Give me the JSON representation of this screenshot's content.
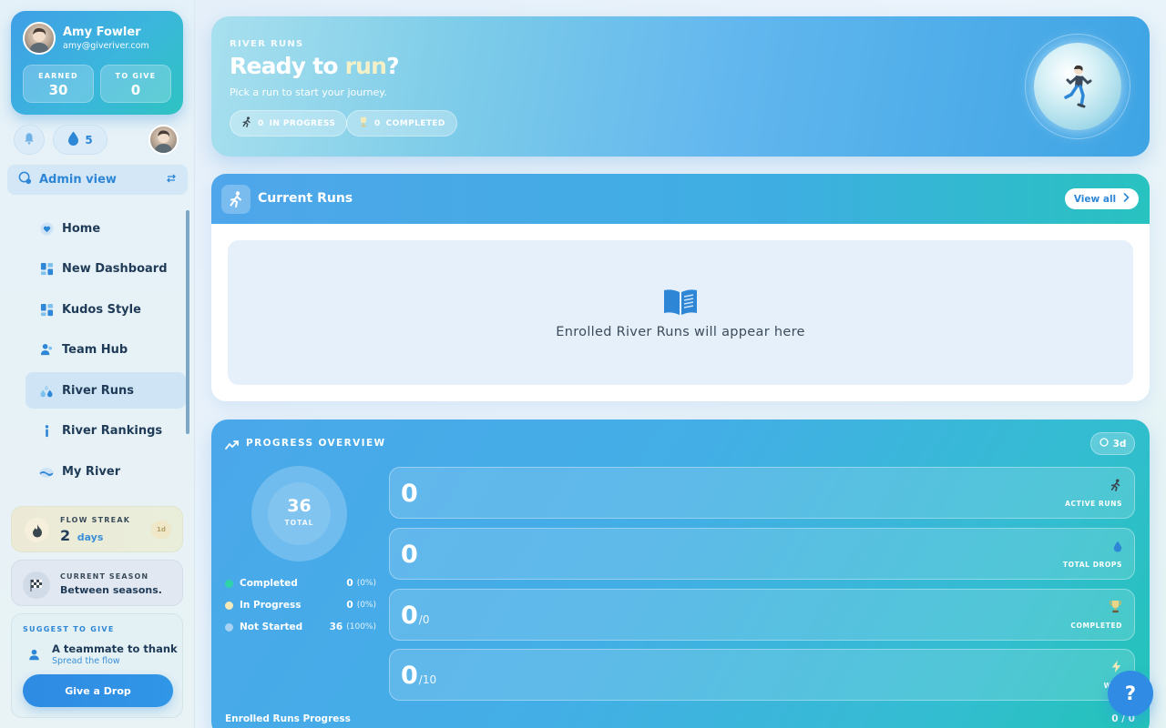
{
  "profile": {
    "name": "Amy Fowler",
    "email": "amy@giveriver.com",
    "earned_label": "EARNED",
    "earned_value": "30",
    "give_label": "TO GIVE",
    "give_value": "0"
  },
  "toolbar": {
    "drops_count": "5"
  },
  "admin_view": {
    "label": "Admin view"
  },
  "nav": {
    "items": [
      {
        "label": "Home",
        "icon": "heart-icon"
      },
      {
        "label": "New Dashboard",
        "icon": "dashboard-icon"
      },
      {
        "label": "Kudos Style",
        "icon": "dashboard-icon"
      },
      {
        "label": "Team Hub",
        "icon": "people-icon"
      },
      {
        "label": "River Runs",
        "icon": "drops-icon",
        "active": true
      },
      {
        "label": "River Rankings",
        "icon": "info-icon"
      },
      {
        "label": "My River",
        "icon": "river-icon"
      }
    ]
  },
  "streak": {
    "label": "FLOW STREAK",
    "value": "2",
    "unit": "days",
    "badge": "1d"
  },
  "season": {
    "label": "CURRENT SEASON",
    "value": "Between seasons."
  },
  "suggest": {
    "label": "SUGGEST TO GIVE",
    "title": "A teammate to thank",
    "subtitle": "Spread the flow",
    "button": "Give a Drop"
  },
  "hero": {
    "kicker": "RIVER RUNS",
    "title_prefix": "Ready to ",
    "title_accent": "run",
    "title_suffix": "?",
    "subtitle": "Pick a run to start your journey.",
    "in_progress_count": "0",
    "in_progress_label": "IN PROGRESS",
    "completed_count": "0",
    "completed_label": "COMPLETED"
  },
  "current_runs": {
    "title": "Current Runs",
    "view_all": "View all",
    "empty_text": "Enrolled River Runs will appear here"
  },
  "progress": {
    "title": "PROGRESS OVERVIEW",
    "range": "3d",
    "total_value": "36",
    "total_label": "TOTAL",
    "legend": [
      {
        "name": "Completed",
        "value": "0",
        "pct": "(0%)",
        "color": "#2ed3a6"
      },
      {
        "name": "In Progress",
        "value": "0",
        "pct": "(0%)",
        "color": "#f4e9b8"
      },
      {
        "name": "Not Started",
        "value": "36",
        "pct": "(100%)",
        "color": "#a9d3f3"
      }
    ],
    "metrics": [
      {
        "value": "0",
        "denom": "",
        "label": "ACTIVE RUNS",
        "icon": "runner-icon"
      },
      {
        "value": "0",
        "denom": "",
        "label": "TOTAL DROPS",
        "icon": "drop-icon"
      },
      {
        "value": "0",
        "denom": "/0",
        "label": "COMPLETED",
        "icon": "trophy-icon"
      },
      {
        "value": "0",
        "denom": "/10",
        "label": "WEE",
        "icon": "lightning-icon"
      }
    ],
    "enrolled_label": "Enrolled Runs Progress",
    "enrolled_value": "0 / 0"
  },
  "help": {
    "label": "?"
  }
}
